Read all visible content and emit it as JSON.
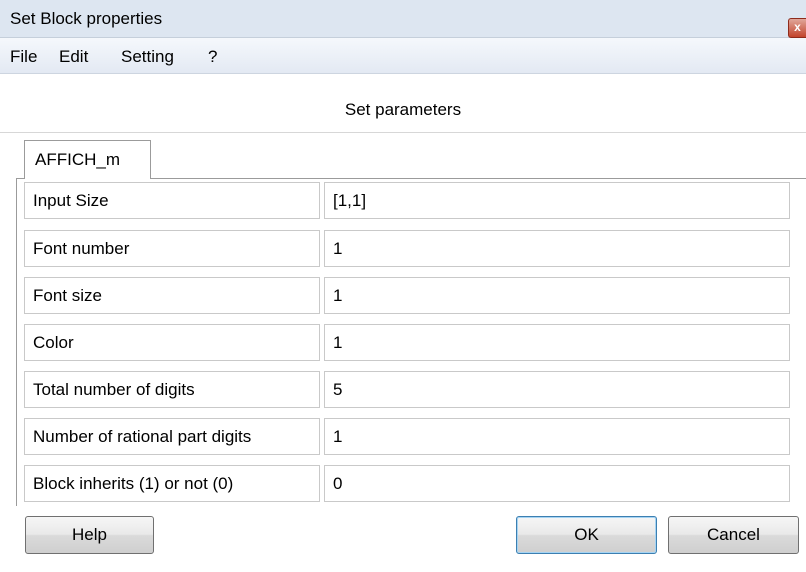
{
  "window": {
    "title": "Set Block properties",
    "close_glyph": "x"
  },
  "menu": {
    "items": [
      "File",
      "Edit",
      "Setting",
      "?"
    ]
  },
  "header": {
    "title": "Set  parameters"
  },
  "tabs": [
    {
      "label": "AFFICH_m",
      "active": true
    }
  ],
  "params": [
    {
      "label": "Input Size",
      "value": "[1,1]"
    },
    {
      "label": "Font number",
      "value": "1"
    },
    {
      "label": "Font size",
      "value": "1"
    },
    {
      "label": "Color",
      "value": "1"
    },
    {
      "label": "Total number of digits",
      "value": "5"
    },
    {
      "label": "Number of rational part digits",
      "value": "1"
    },
    {
      "label": "Block inherits (1) or not (0)",
      "value": "0"
    }
  ],
  "buttons": {
    "help": "Help",
    "ok": "OK",
    "cancel": "Cancel"
  },
  "colors": {
    "titlebar": "#dde6f1",
    "close": "#c3442c",
    "ok_border": "#3c7fb1"
  },
  "icons": {
    "close": "close-icon"
  }
}
